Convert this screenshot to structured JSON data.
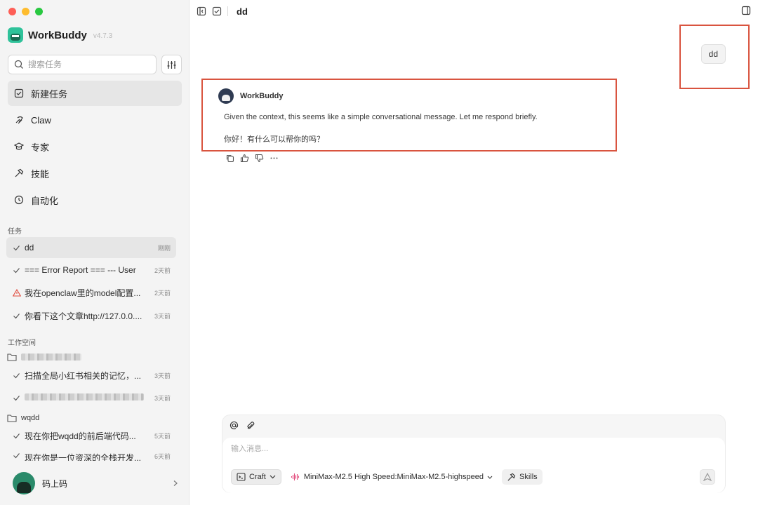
{
  "app": {
    "name": "WorkBuddy",
    "version": "v4.7.3"
  },
  "sidebar": {
    "search_placeholder": "搜索任务",
    "nav": [
      {
        "label": "新建任务",
        "icon": "edit-checkbox-icon"
      },
      {
        "label": "Claw",
        "icon": "claw-icon"
      },
      {
        "label": "专家",
        "icon": "graduation-cap-icon"
      },
      {
        "label": "技能",
        "icon": "hammer-icon"
      },
      {
        "label": "自动化",
        "icon": "clock-icon"
      }
    ],
    "tasks_label": "任务",
    "tasks": [
      {
        "title": "dd",
        "time": "刚刚",
        "status": "done"
      },
      {
        "title": "=== Error Report === --- User",
        "time": "2天前",
        "status": "done"
      },
      {
        "title": "我在openclaw里的model配置...",
        "time": "2天前",
        "status": "warning"
      },
      {
        "title": "你看下这个文章http://127.0.0....",
        "time": "3天前",
        "status": "done"
      }
    ],
    "workspace_label": "工作空间",
    "workspaces": [
      {
        "name": "",
        "tasks": [
          {
            "title": "扫描全局小红书相关的记忆，...",
            "time": "3天前"
          },
          {
            "title": "",
            "time": "3天前"
          }
        ]
      },
      {
        "name": "wqdd",
        "tasks": [
          {
            "title": "现在你把wqdd的前后端代码...",
            "time": "5天前"
          },
          {
            "title": "现在你是一位资深的全栈开发...",
            "time": "6天前"
          }
        ]
      }
    ],
    "user": {
      "name": "码上码"
    }
  },
  "conversation": {
    "title": "dd",
    "user_message": "dd",
    "assistant_name": "WorkBuddy",
    "assistant_lines": [
      "Given the context, this seems like a simple conversational message. Let me respond briefly.",
      "你好！有什么可以帮你的吗？"
    ]
  },
  "composer": {
    "placeholder": "输入消息...",
    "mode": "Craft",
    "model": "MiniMax-M2.5 High Speed:MiniMax-M2.5-highspeed",
    "skills": "Skills"
  },
  "colors": {
    "highlight_border": "#d9543f",
    "sidebar_bg": "#f4f4f4",
    "brand": "#2fc29a"
  }
}
